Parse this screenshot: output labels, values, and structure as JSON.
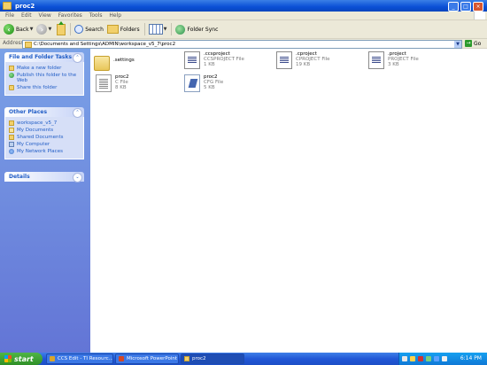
{
  "window": {
    "title": "proc2"
  },
  "menu": [
    "File",
    "Edit",
    "View",
    "Favorites",
    "Tools",
    "Help"
  ],
  "toolbar": {
    "back": "Back",
    "search": "Search",
    "folders": "Folders",
    "folder_sync": "Folder Sync"
  },
  "address": {
    "label": "Address",
    "value": "C:\\Documents and Settings\\ADMIN\\workspace_v5_7\\proc2",
    "go": "Go"
  },
  "sidebar": {
    "file_folder_tasks": {
      "title": "File and Folder Tasks",
      "items": [
        "Make a new folder",
        "Publish this folder to the Web",
        "Share this folder"
      ]
    },
    "other_places": {
      "title": "Other Places",
      "items": [
        "workspace_v5_7",
        "My Documents",
        "Shared Documents",
        "My Computer",
        "My Network Places"
      ]
    },
    "details": {
      "title": "Details"
    }
  },
  "files": [
    {
      "name": ".settings",
      "type": "",
      "size": "",
      "icon": "folder-icon"
    },
    {
      "name": ".ccsproject",
      "type": "CCSPROJECT File",
      "size": "1 KB",
      "icon": "document-icon"
    },
    {
      "name": ".cproject",
      "type": "CPROJECT File",
      "size": "19 KB",
      "icon": "document-icon"
    },
    {
      "name": ".project",
      "type": "PROJECT File",
      "size": "3 KB",
      "icon": "document-icon"
    },
    {
      "name": "proc2",
      "type": "C File",
      "size": "8 KB",
      "icon": "c-file-icon"
    },
    {
      "name": "proc2",
      "type": "CFG File",
      "size": "5 KB",
      "icon": "cfg-file-icon"
    }
  ],
  "taskbar": {
    "start": "start",
    "buttons": [
      "CCS Edit - TI Resourc...",
      "Microsoft PowerPoint ...",
      "proc2"
    ],
    "clock": "6:14 PM"
  }
}
